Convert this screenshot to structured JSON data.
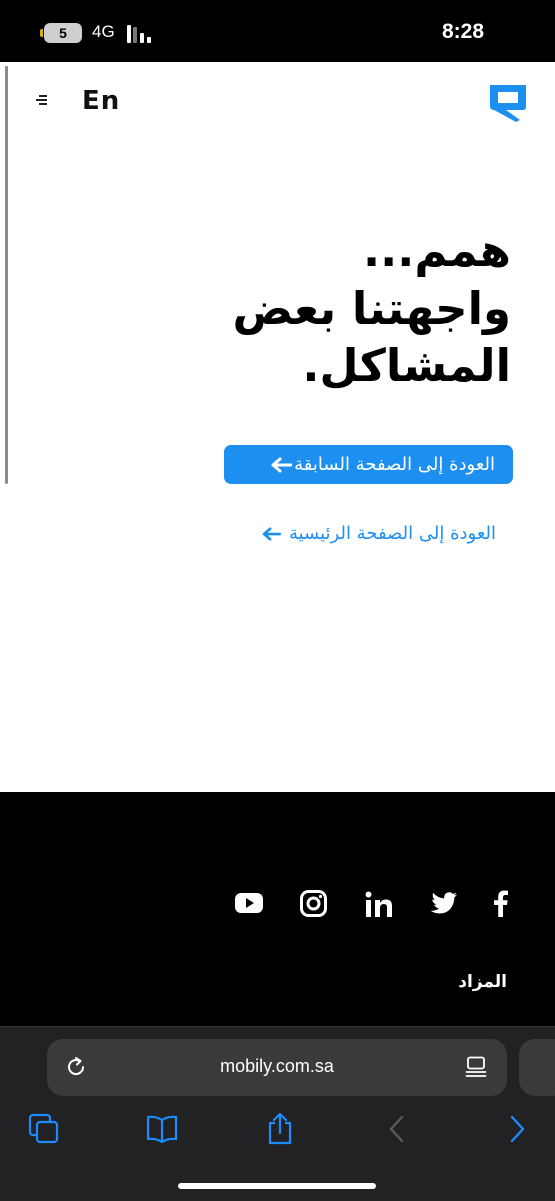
{
  "status_bar": {
    "battery_level": "5",
    "network": "4G",
    "time": "8:28"
  },
  "header": {
    "language_toggle": "En"
  },
  "error": {
    "headline_lines": [
      "همم...",
      "واجهتنا بعض",
      "المشاكل."
    ],
    "back_button_label": "العودة إلى الصفحة السابقة",
    "home_link_label": "العودة إلى الصفحة الرئيسية"
  },
  "footer": {
    "social_icons": [
      "youtube-icon",
      "instagram-icon",
      "linkedin-icon",
      "twitter-icon",
      "facebook-icon"
    ],
    "links": [
      "المزاد"
    ]
  },
  "browser": {
    "url": "mobily.com.sa"
  },
  "colors": {
    "brand_blue": "#1d8ff0",
    "footer_bg": "#000000",
    "toolbar_bg": "#222224"
  }
}
